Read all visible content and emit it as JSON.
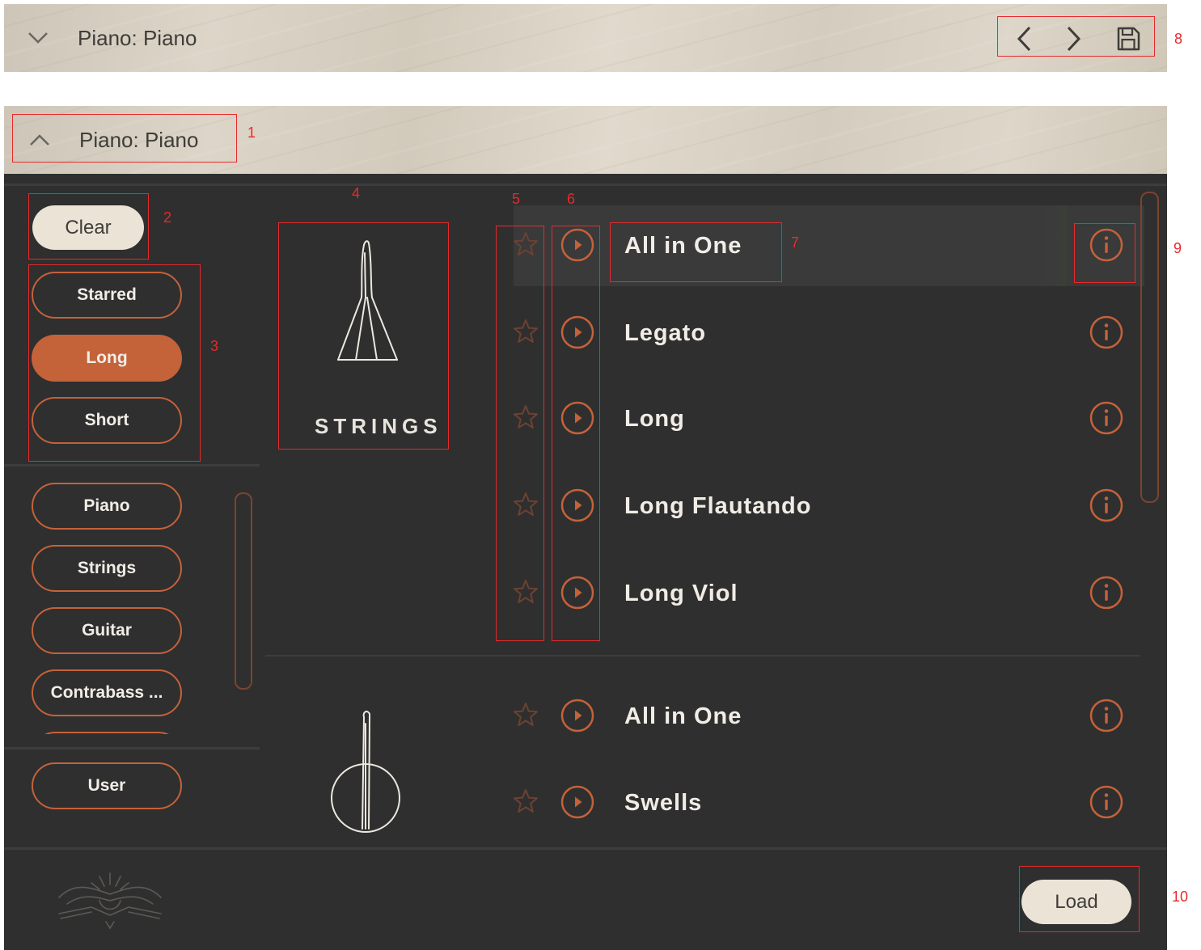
{
  "header_collapsed": {
    "title": "Piano: Piano",
    "chevron_icon": "chevron-down-icon",
    "prev_icon": "chevron-left-icon",
    "next_icon": "chevron-right-icon",
    "save_icon": "save-icon"
  },
  "header_expanded": {
    "title": "Piano: Piano",
    "chevron_icon": "chevron-up-icon"
  },
  "sidebar": {
    "clear_label": "Clear",
    "filters": [
      {
        "label": "Starred",
        "active": false
      },
      {
        "label": "Long",
        "active": true
      },
      {
        "label": "Short",
        "active": false
      }
    ],
    "instruments": [
      {
        "label": "Piano"
      },
      {
        "label": "Strings"
      },
      {
        "label": "Guitar"
      },
      {
        "label": "Contrabass ..."
      }
    ],
    "user_label": "User"
  },
  "categories": [
    {
      "label": "STRINGS",
      "icon": "violin-bow-icon"
    },
    {
      "label": "",
      "icon": "guitar-icon"
    }
  ],
  "groups": [
    {
      "presets": [
        {
          "name": "All in One",
          "selected": true
        },
        {
          "name": "Legato",
          "selected": false
        },
        {
          "name": "Long",
          "selected": false
        },
        {
          "name": "Long Flautando",
          "selected": false
        },
        {
          "name": "Long Viol",
          "selected": false
        }
      ]
    },
    {
      "presets": [
        {
          "name": "All in One",
          "selected": false
        },
        {
          "name": "Swells",
          "selected": false
        }
      ]
    }
  ],
  "footer": {
    "load_label": "Load",
    "logo_icon": "bird-emblem-logo"
  },
  "annotations": [
    "1",
    "2",
    "3",
    "4",
    "5",
    "6",
    "7",
    "8",
    "9",
    "10"
  ],
  "colors": {
    "accent": "#c4623a",
    "panel_bg": "#2f2f2f",
    "button_bg": "#eae3d6",
    "text_light": "#f1ede6",
    "annotation": "#e8292c"
  }
}
